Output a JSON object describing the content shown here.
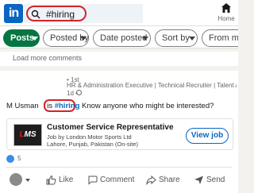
{
  "header": {
    "logo_text": "in",
    "search_value": "#hiring",
    "home_label": "Home"
  },
  "filters": {
    "posts": "Posts",
    "posted_by": "Posted by",
    "date_posted": "Date posted",
    "sort_by": "Sort by",
    "from_member": "From mem"
  },
  "load_more": "Load more comments",
  "post": {
    "degree": "• 1st",
    "headline": "HR & Administration Executive | Technical Recruiter | Talent Acquisition Speci...",
    "meta": "1d •",
    "author_short": "M Usman",
    "text_prefix": "is ",
    "hashtag": "#hiring",
    "text_suffix": " Know anyone who might be interested?",
    "job": {
      "logo_text": "LMS",
      "title": "Customer Service Representative",
      "company": "Job by London Motor Sports Ltd",
      "location": "Lahore, Punjab, Pakistan (On-site)",
      "cta": "View job"
    },
    "reaction_count": "5",
    "actions": {
      "like": "Like",
      "comment": "Comment",
      "share": "Share",
      "send": "Send"
    }
  },
  "colors": {
    "brand": "#0a66c2",
    "posts_chip": "#057642",
    "highlight": "#d6222a"
  }
}
